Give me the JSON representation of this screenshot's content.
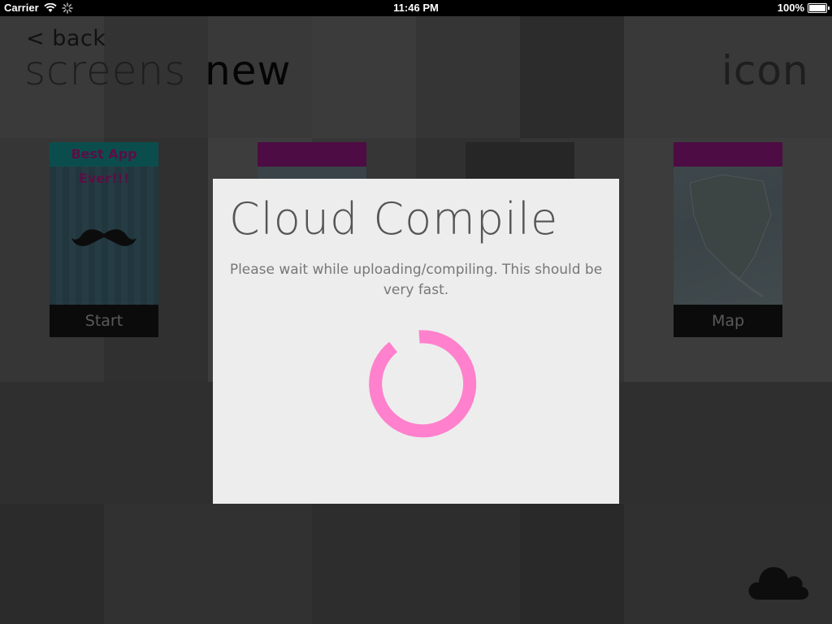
{
  "status_bar": {
    "carrier": "Carrier",
    "time": "11:46 PM",
    "battery": "100%",
    "battery_level": 1.0
  },
  "header": {
    "back_label": "< back",
    "screens_title": "screens",
    "new_title": "new",
    "icon_title": "icon"
  },
  "screens": [
    {
      "label": "Start",
      "banner": "Best App Ever!!!",
      "icon": "mustache-icon"
    },
    {
      "label": "",
      "icon": "map-thumbnail"
    },
    {
      "label": "",
      "icon": "blank-thumbnail"
    },
    {
      "label": "Map",
      "icon": "map-thumbnail"
    }
  ],
  "modal": {
    "title": "Cloud Compile",
    "message": "Please wait while uploading/compiling. This should be very fast.",
    "spinner_color": "#ff80cc",
    "spinner_icon": "loading-spinner-icon"
  },
  "toolbar": {
    "cloud_icon": "cloud-icon"
  },
  "colors": {
    "overlay_bg": "#2e2e2e",
    "modal_bg": "#ededed",
    "accent_pink": "#ff80cc",
    "start_banner": "#0a8a8a",
    "map_banner": "#7a0a6a"
  }
}
